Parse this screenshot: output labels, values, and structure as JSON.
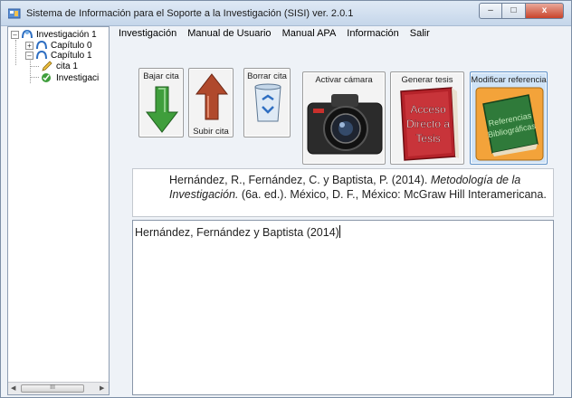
{
  "window": {
    "title": "Sistema de Información para el Soporte a la Investigación  (SISI) ver. 2.0.1",
    "buttons": {
      "minimize": "–",
      "maximize": "□",
      "close": "x"
    }
  },
  "tree": {
    "nodes": [
      {
        "label": "Investigación 1",
        "expander": "–",
        "icon": "research-icon"
      },
      {
        "label": "Capítulo 0",
        "expander": "+",
        "icon": "chapter-icon"
      },
      {
        "label": "Capítulo 1",
        "expander": "–",
        "icon": "chapter-icon"
      },
      {
        "label": "cita 1",
        "expander": "",
        "icon": "pencil-icon"
      },
      {
        "label": "Investigaci",
        "expander": "",
        "icon": "research-check-icon"
      }
    ],
    "scroll_thumb": "III"
  },
  "menu": {
    "items": [
      "Investigación",
      "Manual de Usuario",
      "Manual APA",
      "Información",
      "Salir"
    ]
  },
  "toolbar": {
    "bajar_cita": "Bajar cita",
    "subir_cita": "Subir cita",
    "borrar_cita": "Borrar cita",
    "activar_camara": "Activar cámara",
    "generar_tesis": "Generar tesis",
    "modificar_referencia": "Modificar referencia",
    "tesis_image_text": [
      "Acceso",
      "Directo a",
      "Tesis"
    ],
    "referencias_image_text": [
      "Referencias",
      "Bibliográficas"
    ]
  },
  "reference": {
    "part1": "Hernández, R., Fernández, C. y Baptista, P. (2014). ",
    "title": "Metodología de la Investigación.",
    "part2": " (6a. ed.).  México, D. F., México: McGraw Hill Interamericana."
  },
  "citation": {
    "text": "Hernández, Fernández y Baptista (2014)"
  },
  "colors": {
    "accent": "#2f6fc2",
    "selected_button_bg": "#cfe3f7",
    "download_arrow": "#3f9e3c",
    "upload_arrow": "#b0492c"
  }
}
